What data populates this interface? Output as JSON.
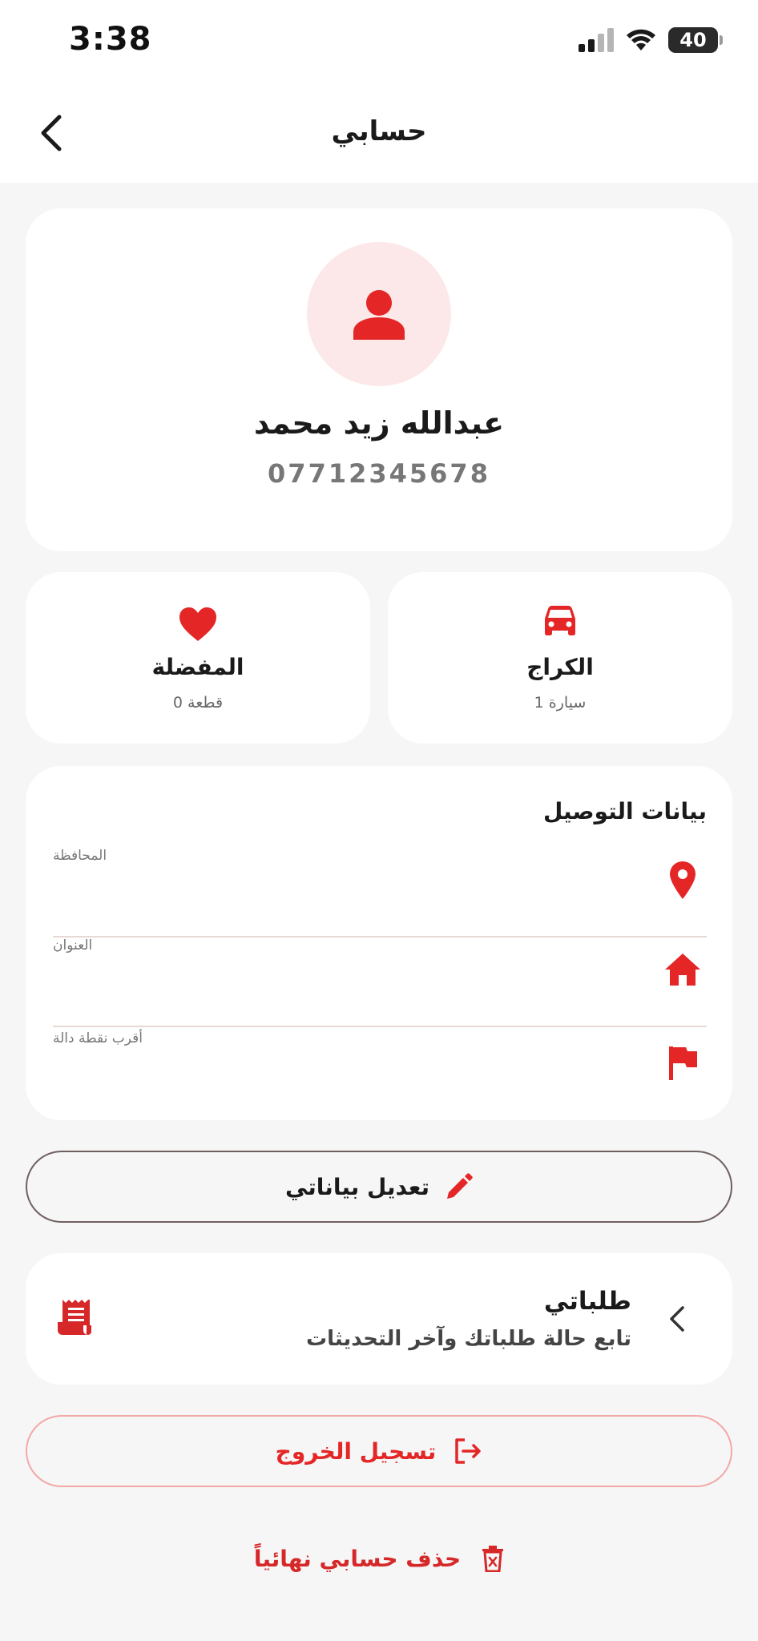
{
  "status_bar": {
    "time": "3:38",
    "battery": "40"
  },
  "nav": {
    "title": "حسابي"
  },
  "profile": {
    "name": "عبدالله زيد محمد",
    "phone": "07712345678"
  },
  "stats": {
    "favorites": {
      "title": "المفضلة",
      "subtitle": "قطعة 0"
    },
    "garage": {
      "title": "الكراج",
      "subtitle": "سيارة 1"
    }
  },
  "delivery": {
    "title": "بيانات التوصيل",
    "fields": [
      {
        "label": "المحافظة",
        "value": ""
      },
      {
        "label": "العنوان",
        "value": ""
      },
      {
        "label": "أقرب نقطة دالة",
        "value": ""
      }
    ]
  },
  "edit_button": {
    "label": "تعديل بياناتي"
  },
  "orders": {
    "title": "طلباتي",
    "subtitle": "تابع حالة طلباتك وآخر التحديثات"
  },
  "logout": {
    "label": "تسجيل الخروج"
  },
  "delete_account": {
    "label": "حذف حسابي نهائياً"
  },
  "colors": {
    "accent": "#e42626",
    "avatar_bg": "#fce8e8",
    "background": "#f6f6f6"
  }
}
